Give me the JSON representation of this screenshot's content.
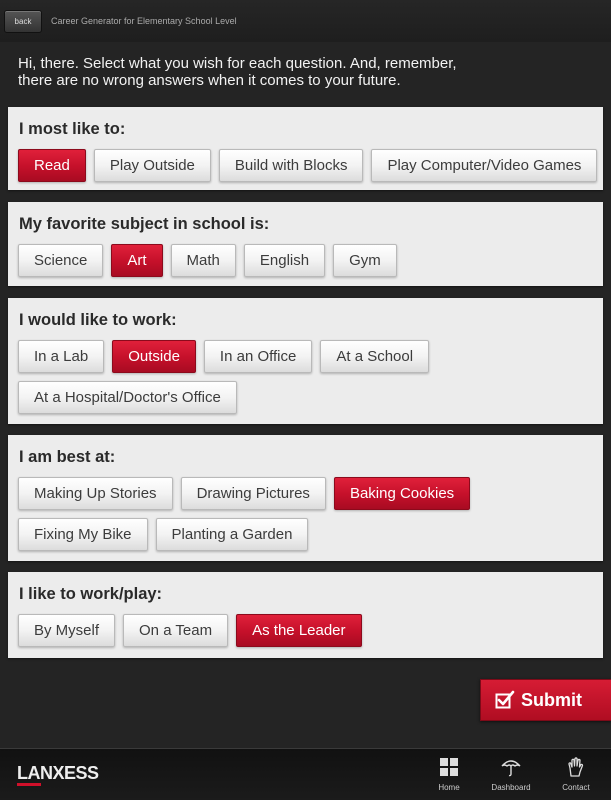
{
  "header": {
    "back_label": "back",
    "title": "Career Generator for Elementary School Level"
  },
  "intro": "Hi, there. Select what you wish for each question. And, remember, there are no wrong answers when it comes to your future.",
  "questions": [
    {
      "title": "I most like to:",
      "options": [
        {
          "label": "Read",
          "selected": true
        },
        {
          "label": "Play Outside",
          "selected": false
        },
        {
          "label": "Build with Blocks",
          "selected": false
        },
        {
          "label": "Play Computer/Video Games",
          "selected": false
        }
      ]
    },
    {
      "title": "My favorite subject in school is:",
      "options": [
        {
          "label": "Science",
          "selected": false
        },
        {
          "label": "Art",
          "selected": true
        },
        {
          "label": "Math",
          "selected": false
        },
        {
          "label": "English",
          "selected": false
        },
        {
          "label": "Gym",
          "selected": false
        }
      ]
    },
    {
      "title": "I would like to work:",
      "options": [
        {
          "label": "In a Lab",
          "selected": false
        },
        {
          "label": "Outside",
          "selected": true
        },
        {
          "label": "In an Office",
          "selected": false
        },
        {
          "label": "At a School",
          "selected": false
        },
        {
          "label": "At a Hospital/Doctor's Office",
          "selected": false
        }
      ]
    },
    {
      "title": "I am best at:",
      "options": [
        {
          "label": "Making Up Stories",
          "selected": false
        },
        {
          "label": "Drawing Pictures",
          "selected": false
        },
        {
          "label": "Baking Cookies",
          "selected": true
        },
        {
          "label": "Fixing My Bike",
          "selected": false
        },
        {
          "label": "Planting a Garden",
          "selected": false
        }
      ]
    },
    {
      "title": "I like to work/play:",
      "options": [
        {
          "label": "By Myself",
          "selected": false
        },
        {
          "label": "On a Team",
          "selected": false
        },
        {
          "label": "As the Leader",
          "selected": true
        }
      ]
    }
  ],
  "submit_label": "Submit",
  "footer": {
    "logo": "LANXESS",
    "nav": [
      {
        "label": "Home",
        "icon": "grid-icon"
      },
      {
        "label": "Dashboard",
        "icon": "umbrella-icon"
      },
      {
        "label": "Contact",
        "icon": "hand-icon"
      }
    ]
  },
  "colors": {
    "accent": "#c4102a",
    "panel": "#ececec",
    "background": "#242424"
  }
}
